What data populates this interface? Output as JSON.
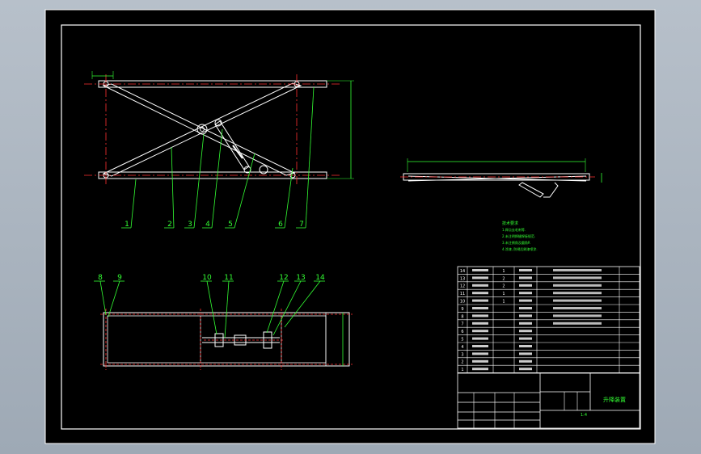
{
  "drawing": {
    "title": "升降装置",
    "balloons_front": [
      "1",
      "2",
      "3",
      "4",
      "5",
      "6",
      "7"
    ],
    "balloons_top": [
      "8",
      "9",
      "10",
      "11",
      "12",
      "13",
      "14"
    ],
    "tech_requirements": {
      "heading": "技术要求",
      "lines": [
        "1.焊点去毛刺等.",
        "2.未注明焊缝焊接规范.",
        "3.未注倒角及圆角R",
        "4.涂漆, 防锈后刷漆喷涂."
      ]
    },
    "parts_rows": [
      {
        "no": "14",
        "name": "",
        "qty": "1",
        "mat": ""
      },
      {
        "no": "13",
        "name": "",
        "qty": "2",
        "mat": ""
      },
      {
        "no": "12",
        "name": "",
        "qty": "2",
        "mat": ""
      },
      {
        "no": "11",
        "name": "",
        "qty": "1",
        "mat": ""
      },
      {
        "no": "10",
        "name": "",
        "qty": "1",
        "mat": ""
      },
      {
        "no": "9",
        "name": "",
        "qty": "",
        "mat": ""
      },
      {
        "no": "8",
        "name": "",
        "qty": "",
        "mat": ""
      },
      {
        "no": "7",
        "name": "",
        "qty": "",
        "mat": ""
      },
      {
        "no": "6",
        "name": "",
        "qty": "",
        "mat": ""
      },
      {
        "no": "5",
        "name": "",
        "qty": "",
        "mat": ""
      },
      {
        "no": "4",
        "name": "",
        "qty": "",
        "mat": ""
      },
      {
        "no": "3",
        "name": "",
        "qty": "",
        "mat": ""
      },
      {
        "no": "2",
        "name": "",
        "qty": "",
        "mat": ""
      },
      {
        "no": "1",
        "name": "",
        "qty": "",
        "mat": ""
      }
    ],
    "title_block": {
      "ratio": "1:4",
      "sheet": ""
    }
  }
}
